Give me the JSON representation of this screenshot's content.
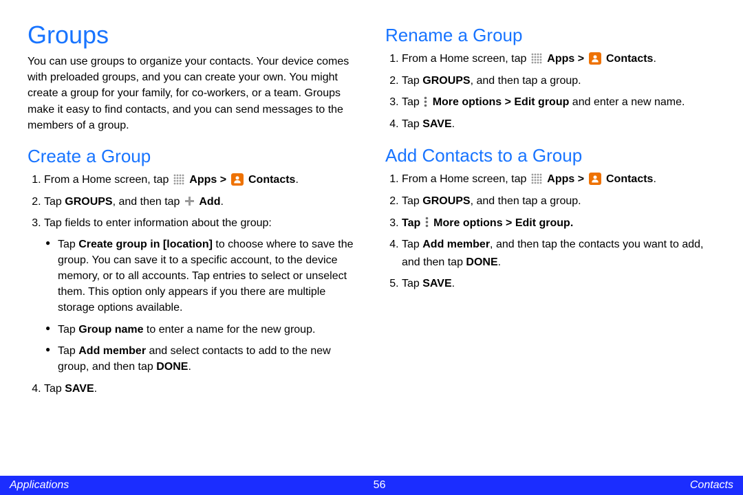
{
  "page": {
    "heading": "Groups",
    "intro": "You can use groups to organize your contacts. Your device comes with preloaded groups, and you can create your own. You might create a group for your family, for co-workers, or a team. Groups make it easy to find contacts, and you can send messages to the members of a group."
  },
  "create": {
    "heading": "Create a Group",
    "step1_a": "From a Home screen, tap ",
    "step1_apps": "Apps > ",
    "step1_contacts": "Contacts",
    "step1_period": ".",
    "step2_a": "Tap ",
    "step2_groups": "GROUPS",
    "step2_b": ", and then tap ",
    "step2_add": "Add",
    "step2_period": ".",
    "step3": "Tap fields to enter information about the group:",
    "bullet1_a": "Tap ",
    "bullet1_b": "Create group in [location]",
    "bullet1_c": " to choose where to save the group. You can save it to a specific account, to the device memory, or to all accounts. Tap entries to select or unselect them. This option only appears if you there are multiple storage options available.",
    "bullet2_a": "Tap ",
    "bullet2_b": "Group name",
    "bullet2_c": " to enter a name for the new group.",
    "bullet3_a": "Tap ",
    "bullet3_b": "Add member",
    "bullet3_c": " and select contacts to add to the new group, and then tap ",
    "bullet3_d": "DONE",
    "bullet3_e": ".",
    "step4_a": "Tap ",
    "step4_b": "SAVE",
    "step4_c": "."
  },
  "rename": {
    "heading": "Rename a Group",
    "step1_a": "From a Home screen, tap ",
    "step1_apps": "Apps > ",
    "step1_contacts": "Contacts",
    "step1_period": ".",
    "step2_a": "Tap ",
    "step2_b": "GROUPS",
    "step2_c": ", and then tap a group.",
    "step3_a": "Tap ",
    "step3_b": "More options > Edit group",
    "step3_c": " and enter a new name.",
    "step4_a": "Tap ",
    "step4_b": "SAVE",
    "step4_c": "."
  },
  "addcontacts": {
    "heading": "Add Contacts to a Group",
    "step1_a": "From a Home screen, tap ",
    "step1_apps": "Apps > ",
    "step1_contacts": "Contacts",
    "step1_period": ".",
    "step2_a": "Tap ",
    "step2_b": "GROUPS",
    "step2_c": ", and then tap a group.",
    "step3_a": "Tap ",
    "step3_b": "More options > Edit group",
    "step3_c": ".",
    "step4_a": "Tap ",
    "step4_b": "Add member",
    "step4_c": ", and then tap the contacts you want to add, and then tap ",
    "step4_d": "DONE",
    "step4_e": ".",
    "step5_a": "Tap ",
    "step5_b": "SAVE",
    "step5_c": "."
  },
  "footer": {
    "left": "Applications",
    "center": "56",
    "right": "Contacts"
  }
}
